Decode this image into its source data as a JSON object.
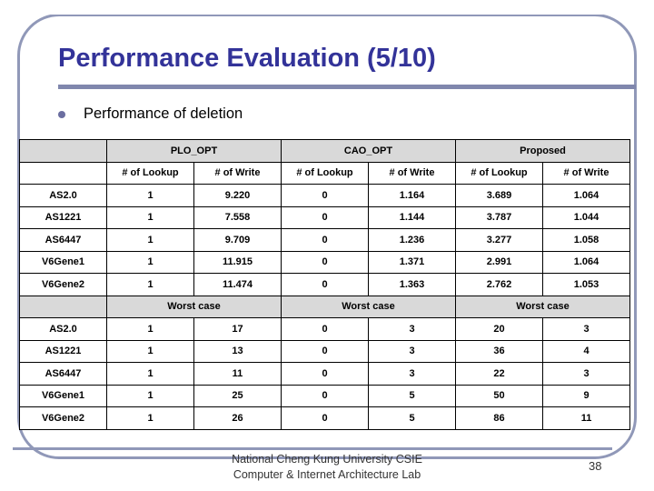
{
  "slide": {
    "title": "Performance Evaluation (5/10)",
    "bullet": "Performance of deletion",
    "page_number": "38",
    "colors": {
      "title": "#333399",
      "rule": "#8087ad",
      "frame": "#9098b8",
      "header_fill": "#d9d9d9",
      "bullet": "#6b6ea0"
    }
  },
  "footer": {
    "line1": "National Cheng Kung University CSIE",
    "line2": "Computer & Internet Architecture Lab"
  },
  "table": {
    "corner_label": "",
    "groups": [
      {
        "name": "PLO_OPT"
      },
      {
        "name": "CAO_OPT"
      },
      {
        "name": "Proposed"
      }
    ],
    "subheaders": [
      "# of Lookup",
      "# of Write",
      "# of Lookup",
      "# of Write",
      "# of Lookup",
      "# of Write"
    ],
    "worst_case_label": "Worst case",
    "average_rows": [
      {
        "label": "AS2.0",
        "values": [
          "1",
          "9.220",
          "0",
          "1.164",
          "3.689",
          "1.064"
        ]
      },
      {
        "label": "AS1221",
        "values": [
          "1",
          "7.558",
          "0",
          "1.144",
          "3.787",
          "1.044"
        ]
      },
      {
        "label": "AS6447",
        "values": [
          "1",
          "9.709",
          "0",
          "1.236",
          "3.277",
          "1.058"
        ]
      },
      {
        "label": "V6Gene1",
        "values": [
          "1",
          "11.915",
          "0",
          "1.371",
          "2.991",
          "1.064"
        ]
      },
      {
        "label": "V6Gene2",
        "values": [
          "1",
          "11.474",
          "0",
          "1.363",
          "2.762",
          "1.053"
        ]
      }
    ],
    "worst_rows": [
      {
        "label": "AS2.0",
        "values": [
          "1",
          "17",
          "0",
          "3",
          "20",
          "3"
        ]
      },
      {
        "label": "AS1221",
        "values": [
          "1",
          "13",
          "0",
          "3",
          "36",
          "4"
        ]
      },
      {
        "label": "AS6447",
        "values": [
          "1",
          "11",
          "0",
          "3",
          "22",
          "3"
        ]
      },
      {
        "label": "V6Gene1",
        "values": [
          "1",
          "25",
          "0",
          "5",
          "50",
          "9"
        ]
      },
      {
        "label": "V6Gene2",
        "values": [
          "1",
          "26",
          "0",
          "5",
          "86",
          "11"
        ]
      }
    ]
  }
}
